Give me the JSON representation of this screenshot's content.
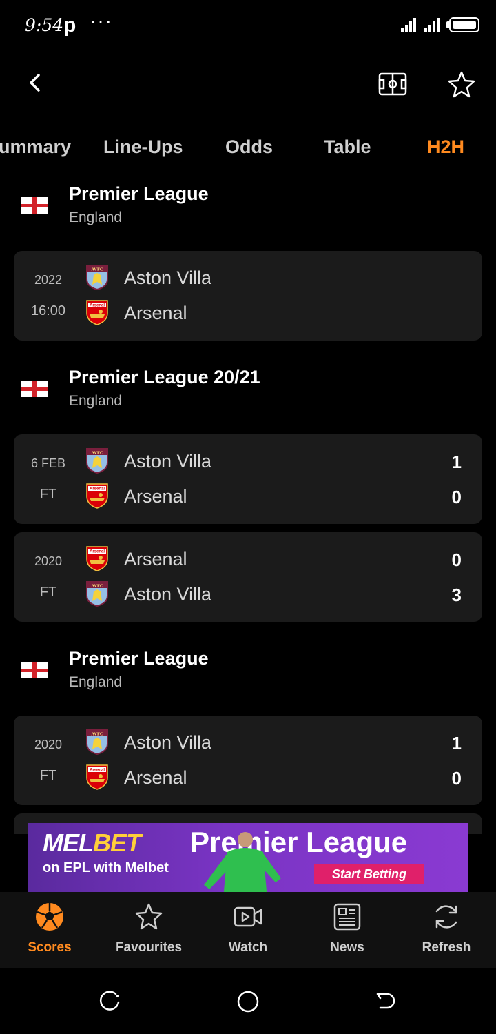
{
  "status_bar": {
    "time": "9:54",
    "app_letter": "p",
    "more": "···"
  },
  "header": {
    "back_icon": "back-arrow-icon",
    "pitch_icon": "football-pitch-icon",
    "favourite_icon": "star-icon"
  },
  "tabs": [
    {
      "label": "Summary",
      "visible_label": "ummary"
    },
    {
      "label": "Line-Ups"
    },
    {
      "label": "Odds"
    },
    {
      "label": "Table"
    },
    {
      "label": "H2H",
      "active": true
    }
  ],
  "groups": [
    {
      "league": "Premier League",
      "country": "England",
      "matches": [
        {
          "date": "2022",
          "status": "16:00",
          "home": "Aston Villa",
          "away": "Arsenal",
          "home_score": "",
          "away_score": "",
          "home_crest": "aston-villa",
          "away_crest": "arsenal"
        }
      ]
    },
    {
      "league": "Premier League 20/21",
      "country": "England",
      "matches": [
        {
          "date": "6 FEB",
          "status": "FT",
          "home": "Aston Villa",
          "away": "Arsenal",
          "home_score": "1",
          "away_score": "0",
          "home_crest": "aston-villa",
          "away_crest": "arsenal"
        },
        {
          "date": "2020",
          "status": "FT",
          "home": "Arsenal",
          "away": "Aston Villa",
          "home_score": "0",
          "away_score": "3",
          "home_crest": "arsenal",
          "away_crest": "aston-villa"
        }
      ]
    },
    {
      "league": "Premier League",
      "country": "England",
      "matches": [
        {
          "date": "2020",
          "status": "FT",
          "home": "Aston Villa",
          "away": "Arsenal",
          "home_score": "1",
          "away_score": "0",
          "home_crest": "aston-villa",
          "away_crest": "arsenal"
        }
      ]
    }
  ],
  "crest_text": {
    "aston-villa": "AVFC",
    "arsenal": "Arsenal"
  },
  "banner": {
    "brand_a": "MEL",
    "brand_b": "BET",
    "subline": "on EPL with Melbet",
    "headline": "Premier League",
    "cta": "Start Betting"
  },
  "bottom_nav": [
    {
      "label": "Scores",
      "icon": "soccer-ball-icon",
      "active": true
    },
    {
      "label": "Favourites",
      "icon": "star-icon"
    },
    {
      "label": "Watch",
      "icon": "video-icon"
    },
    {
      "label": "News",
      "icon": "newspaper-icon"
    },
    {
      "label": "Refresh",
      "icon": "refresh-icon"
    }
  ],
  "colors": {
    "accent": "#ff8a1f",
    "background": "#000000",
    "card": "#1b1b1b",
    "aston_villa_claret": "#7a1f3d",
    "aston_villa_blue": "#95bfe5",
    "arsenal_red": "#db0007"
  }
}
